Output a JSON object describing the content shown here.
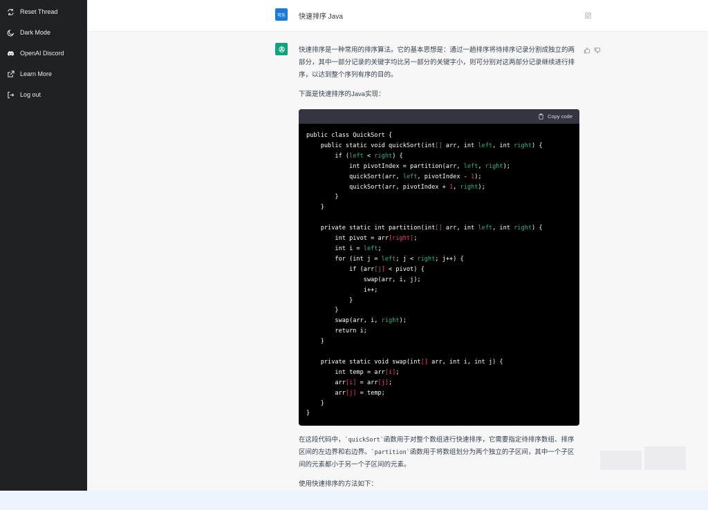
{
  "sidebar": {
    "items": [
      {
        "label": "Reset Thread",
        "icon": "refresh-icon"
      },
      {
        "label": "Dark Mode",
        "icon": "moon-icon"
      },
      {
        "label": "OpenAI Discord",
        "icon": "discord-icon"
      },
      {
        "label": "Learn More",
        "icon": "external-link-icon"
      },
      {
        "label": "Log out",
        "icon": "logout-icon"
      }
    ]
  },
  "user_message": {
    "avatar_text": "可乐",
    "text": "快速排序 Java"
  },
  "assistant": {
    "intro": "快速排序是一种常用的排序算法。它的基本思想是：通过一趟排序将待排序记录分割成独立的两部分，其中一部分记录的关键字均比另一部分的关键字小，则可分别对这两部分记录继续进行排序，以达到整个序列有序的目的。",
    "lead": "下面是快速排序的Java实现：",
    "copy_label": "Copy code",
    "explain_prefix": "在这段代码中，",
    "explain_code1": "`quickSort`",
    "explain_mid": "函数用于对整个数组进行快速排序，它需要指定待排序数组、排序区间的左边界和右边界。",
    "explain_code2": "`partition`",
    "explain_suffix": "函数用于将数组划分为两个独立的子区间，其中一个子区间的元素都小于另一个子区间的元素。",
    "usage": "使用快速排序的方法如下："
  },
  "colors": {
    "sidebar_bg": "#202123",
    "user_avatar": "#1a7bd4",
    "bot_avatar": "#10a37f",
    "code_bg": "#000000",
    "code_highlight": "#2bb58a",
    "code_red": "#e9416e"
  }
}
